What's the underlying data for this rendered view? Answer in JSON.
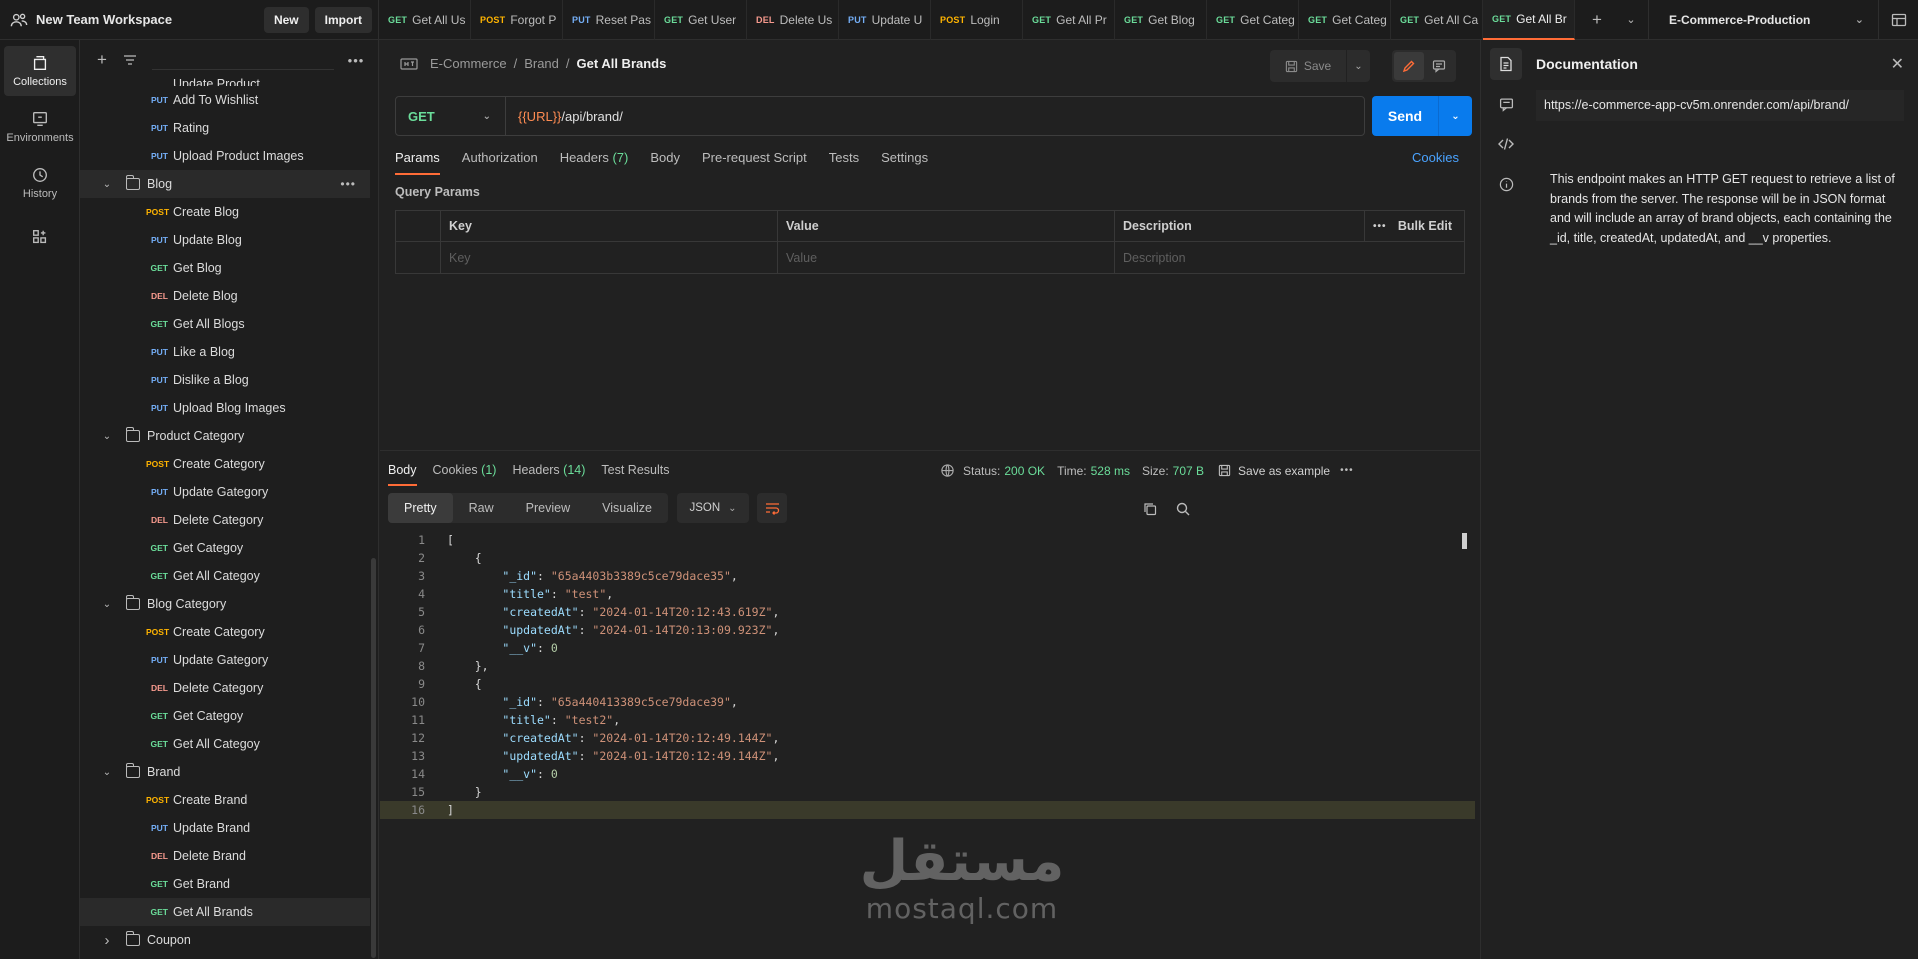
{
  "workspace": {
    "name": "New Team Workspace",
    "new_label": "New",
    "import_label": "Import"
  },
  "tabs": [
    {
      "method": "GET",
      "label": "Get All Us"
    },
    {
      "method": "POST",
      "label": "Forgot P"
    },
    {
      "method": "PUT",
      "label": "Reset Pas"
    },
    {
      "method": "GET",
      "label": "Get User"
    },
    {
      "method": "DEL",
      "label": "Delete Us"
    },
    {
      "method": "PUT",
      "label": "Update U"
    },
    {
      "method": "POST",
      "label": "Login"
    },
    {
      "method": "GET",
      "label": "Get All Pr"
    },
    {
      "method": "GET",
      "label": "Get Blog"
    },
    {
      "method": "GET",
      "label": "Get Categ"
    },
    {
      "method": "GET",
      "label": "Get Categ"
    },
    {
      "method": "GET",
      "label": "Get All Ca"
    },
    {
      "method": "GET",
      "label": "Get All Br"
    }
  ],
  "environment": {
    "name": "E-Commerce-Production"
  },
  "rail": {
    "collections": "Collections",
    "environments": "Environments",
    "history": "History"
  },
  "sidebar": {
    "rows": [
      {
        "kind": "req",
        "method": "",
        "label": "Update Product",
        "partial": true
      },
      {
        "kind": "req",
        "method": "PUT",
        "label": "Add To Wishlist"
      },
      {
        "kind": "req",
        "method": "PUT",
        "label": "Rating"
      },
      {
        "kind": "req",
        "method": "PUT",
        "label": "Upload Product Images"
      },
      {
        "kind": "folder",
        "label": "Blog",
        "open": true,
        "highlight": true
      },
      {
        "kind": "req",
        "method": "POST",
        "label": "Create Blog"
      },
      {
        "kind": "req",
        "method": "PUT",
        "label": "Update Blog"
      },
      {
        "kind": "req",
        "method": "GET",
        "label": "Get Blog"
      },
      {
        "kind": "req",
        "method": "DEL",
        "label": "Delete Blog"
      },
      {
        "kind": "req",
        "method": "GET",
        "label": "Get All Blogs"
      },
      {
        "kind": "req",
        "method": "PUT",
        "label": "Like a Blog"
      },
      {
        "kind": "req",
        "method": "PUT",
        "label": "Dislike a Blog"
      },
      {
        "kind": "req",
        "method": "PUT",
        "label": "Upload Blog Images"
      },
      {
        "kind": "folder",
        "label": "Product Category",
        "open": true
      },
      {
        "kind": "req",
        "method": "POST",
        "label": "Create Category"
      },
      {
        "kind": "req",
        "method": "PUT",
        "label": "Update Gategory"
      },
      {
        "kind": "req",
        "method": "DEL",
        "label": "Delete Category"
      },
      {
        "kind": "req",
        "method": "GET",
        "label": "Get Categoy"
      },
      {
        "kind": "req",
        "method": "GET",
        "label": "Get All Categoy"
      },
      {
        "kind": "folder",
        "label": "Blog Category",
        "open": true
      },
      {
        "kind": "req",
        "method": "POST",
        "label": "Create Category"
      },
      {
        "kind": "req",
        "method": "PUT",
        "label": "Update Gategory"
      },
      {
        "kind": "req",
        "method": "DEL",
        "label": "Delete Category"
      },
      {
        "kind": "req",
        "method": "GET",
        "label": "Get Categoy"
      },
      {
        "kind": "req",
        "method": "GET",
        "label": "Get All Categoy"
      },
      {
        "kind": "folder",
        "label": "Brand",
        "open": true
      },
      {
        "kind": "req",
        "method": "POST",
        "label": "Create Brand"
      },
      {
        "kind": "req",
        "method": "PUT",
        "label": "Update Brand"
      },
      {
        "kind": "req",
        "method": "DEL",
        "label": "Delete Brand"
      },
      {
        "kind": "req",
        "method": "GET",
        "label": "Get Brand"
      },
      {
        "kind": "req",
        "method": "GET",
        "label": "Get All Brands",
        "highlight": true
      },
      {
        "kind": "folder",
        "label": "Coupon",
        "open": false
      }
    ]
  },
  "breadcrumb": {
    "collection": "E-Commerce",
    "folder": "Brand",
    "current": "Get All Brands"
  },
  "toolbar": {
    "save_label": "Save"
  },
  "request": {
    "method": "GET",
    "url_var": "{{URL}}",
    "url_path": "/api/brand/",
    "send_label": "Send",
    "tabs": {
      "params": "Params",
      "authorization": "Authorization",
      "headers": "Headers",
      "headers_count": "(7)",
      "body": "Body",
      "prerequest": "Pre-request Script",
      "tests": "Tests",
      "settings": "Settings"
    },
    "cookies_link": "Cookies",
    "query_params_title": "Query Params",
    "columns": {
      "key": "Key",
      "value": "Value",
      "description": "Description",
      "bulk_edit": "Bulk Edit"
    },
    "placeholders": {
      "key": "Key",
      "value": "Value",
      "description": "Description"
    }
  },
  "response": {
    "tabs": {
      "body": "Body",
      "cookies": "Cookies",
      "cookies_count": "(1)",
      "headers": "Headers",
      "headers_count": "(14)",
      "test_results": "Test Results"
    },
    "status_label": "Status:",
    "status": "200 OK",
    "time_label": "Time:",
    "time": "528 ms",
    "size_label": "Size:",
    "size": "707 B",
    "save_example": "Save as example",
    "formats": {
      "pretty": "Pretty",
      "raw": "Raw",
      "preview": "Preview",
      "visualize": "Visualize"
    },
    "language": "JSON",
    "lines": [
      "[",
      "    {",
      "        \"_id\": \"65a4403b3389c5ce79dace35\",",
      "        \"title\": \"test\",",
      "        \"createdAt\": \"2024-01-14T20:12:43.619Z\",",
      "        \"updatedAt\": \"2024-01-14T20:13:09.923Z\",",
      "        \"__v\": 0",
      "    },",
      "    {",
      "        \"_id\": \"65a440413389c5ce79dace39\",",
      "        \"title\": \"test2\",",
      "        \"createdAt\": \"2024-01-14T20:12:49.144Z\",",
      "        \"updatedAt\": \"2024-01-14T20:12:49.144Z\",",
      "        \"__v\": 0",
      "    }",
      "]"
    ]
  },
  "docs": {
    "title": "Documentation",
    "url": "https://e-commerce-app-cv5m.onrender.com/api/brand/",
    "description": "This endpoint makes an HTTP GET request to retrieve a list of brands from the server. The response will be in JSON format and will include an array of brand objects, each containing the _id, title, createdAt, updatedAt, and __v properties."
  },
  "watermark": {
    "arabic": "مستقل",
    "latin": "mostaql.com"
  },
  "colors": {
    "get": "#6bdd9a",
    "post": "#ffb400",
    "put": "#74aef6",
    "del": "#f79a8e",
    "accent": "#ff6c37",
    "send": "#097bed"
  }
}
